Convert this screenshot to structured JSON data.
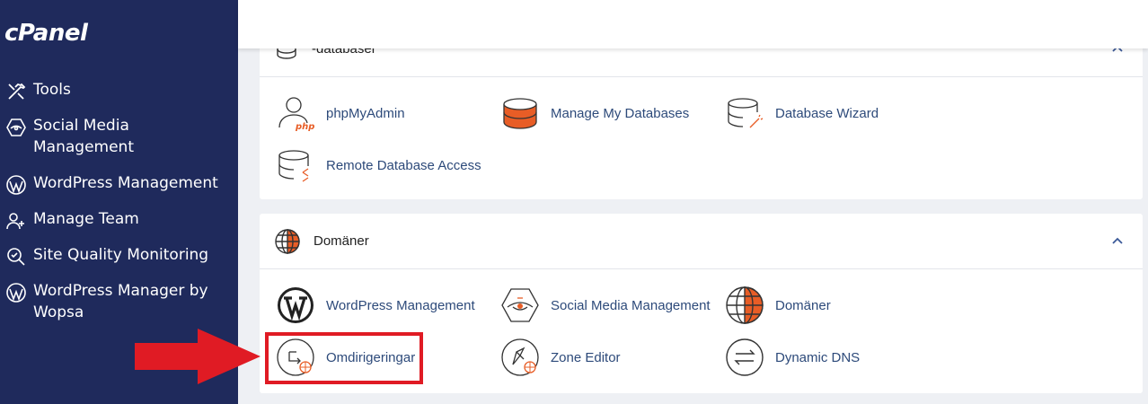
{
  "logo": "cPanel",
  "sidebar": {
    "items": [
      {
        "label": "Tools"
      },
      {
        "label": "Social Media Management"
      },
      {
        "label": "WordPress Management"
      },
      {
        "label": "Manage Team"
      },
      {
        "label": "Site Quality Monitoring"
      },
      {
        "label": "WordPress Manager by Wopsa"
      }
    ]
  },
  "databases": {
    "title": "-databaser",
    "tools": [
      {
        "label": "phpMyAdmin"
      },
      {
        "label": "Manage My Databases"
      },
      {
        "label": "Database Wizard"
      },
      {
        "label": "Remote Database Access"
      }
    ]
  },
  "domains": {
    "title": "Domäner",
    "tools": [
      {
        "label": "WordPress Management"
      },
      {
        "label": "Social Media Management"
      },
      {
        "label": "Domäner"
      },
      {
        "label": "Omdirigeringar"
      },
      {
        "label": "Zone Editor"
      },
      {
        "label": "Dynamic DNS"
      }
    ]
  },
  "colors": {
    "sidebar": "#1f2a5c",
    "accent": "#e85d26",
    "highlight": "#e01b24",
    "link": "#2d4a7a"
  }
}
